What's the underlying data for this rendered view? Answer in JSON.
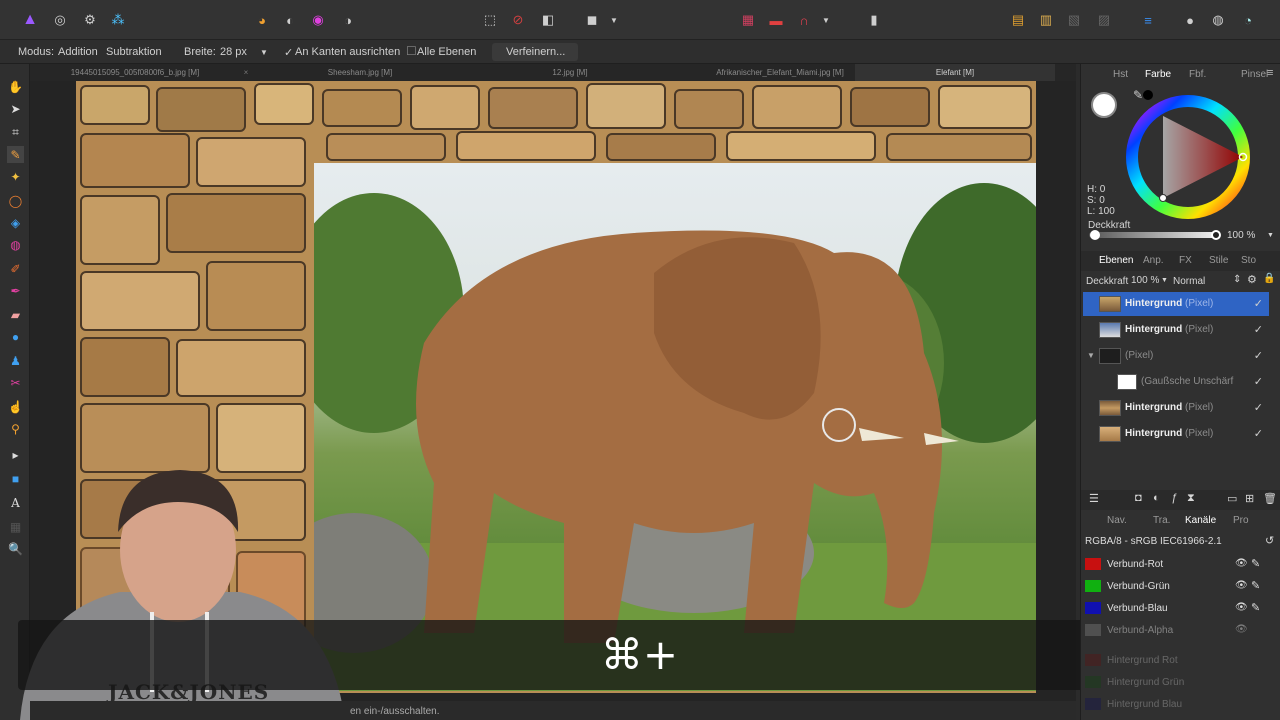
{
  "context_bar": {
    "mode_label": "Modus:",
    "mode_addition": "Addition",
    "mode_subtraction": "Subtraktion",
    "width_label": "Breite:",
    "width_value": "28 px",
    "snap_check": "✓",
    "snap_label": "An Kanten ausrichten",
    "all_layers_label": "Alle Ebenen",
    "refine_button": "Verfeinern..."
  },
  "doc_tabs": [
    {
      "label": "19445015095_005f0800f6_b.jpg [M]"
    },
    {
      "label": "Sheesham.jpg [M]"
    },
    {
      "label": "12.jpg [M]"
    },
    {
      "label": "Afrikanischer_Elefant_Miami.jpg [M]"
    },
    {
      "label": "Elefant [M]"
    }
  ],
  "doc_tab_close": "×",
  "color_panel": {
    "tabs": [
      "Hst",
      "Farbe",
      "Fbf.",
      "Pinsel"
    ],
    "active_tab": "Farbe",
    "h": "H: 0",
    "s": "S: 0",
    "l": "L: 100",
    "opacity_label": "Deckkraft",
    "opacity_value": "100 %"
  },
  "layers_panel": {
    "tabs": [
      "Ebenen",
      "Anp.",
      "FX",
      "Stile",
      "Sto"
    ],
    "active_tab": "Ebenen",
    "opacity_label": "Deckkraft",
    "opacity_value": "100 %",
    "blend_mode": "Normal",
    "layers": [
      {
        "name": "Hintergrund",
        "type": "(Pixel)",
        "selected": true
      },
      {
        "name": "Hintergrund",
        "type": "(Pixel)",
        "selected": false
      },
      {
        "name": "",
        "type": "(Pixel)",
        "selected": false
      },
      {
        "name": "",
        "type": "(Gaußsche Unschärf",
        "selected": false
      },
      {
        "name": "Hintergrund",
        "type": "(Pixel)",
        "selected": false
      },
      {
        "name": "Hintergrund",
        "type": "(Pixel)",
        "selected": false
      }
    ],
    "check": "✓"
  },
  "channels_panel": {
    "tabs": [
      "Nav.",
      "Tra.",
      "Kanäle",
      "Pro"
    ],
    "active_tab": "Kanäle",
    "format": "RGBA/8 - sRGB IEC61966-2.1",
    "channels": [
      {
        "name": "Verbund-Rot",
        "color": "#c81010"
      },
      {
        "name": "Verbund-Grün",
        "color": "#10b010"
      },
      {
        "name": "Verbund-Blau",
        "color": "#1010b0"
      },
      {
        "name": "Verbund-Alpha",
        "color": "#777777"
      },
      {
        "name": "Hintergrund Rot",
        "color": "#6a0a0a"
      },
      {
        "name": "Hintergrund Grün",
        "color": "#0a4a0a"
      },
      {
        "name": "Hintergrund Blau",
        "color": "#0a0a5a"
      }
    ]
  },
  "overlay": {
    "shortcut": "⌘+"
  },
  "status": {
    "text": "en ein-/ausschalten."
  },
  "colors": {
    "accent": "#2f6fd0",
    "selected_row": "#2f64c4"
  }
}
